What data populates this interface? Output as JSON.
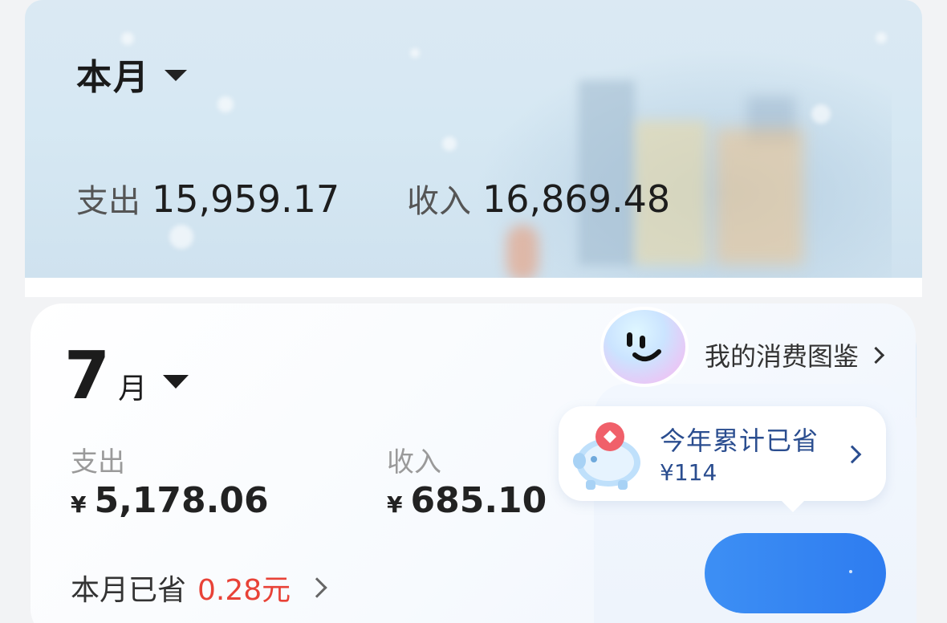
{
  "banner": {
    "period_label": "本月",
    "expense_label": "支出",
    "expense_value": "15,959.17",
    "income_label": "收入",
    "income_value": "16,869.48"
  },
  "month_card": {
    "month_number": "7",
    "month_unit": "月",
    "expense_label": "支出",
    "expense_currency": "¥",
    "expense_value": "5,178.06",
    "income_label": "收入",
    "income_currency": "¥",
    "income_value": "685.10",
    "saved_label": "本月已省",
    "saved_amount": "0.28元"
  },
  "catalog": {
    "link_text": "我的消费图鉴",
    "avatar_icon": "smiley-mascot-icon"
  },
  "savings_tip": {
    "title": "今年累计已省",
    "amount": "¥114",
    "icon": "piggy-bank-icon"
  },
  "colors": {
    "accent_blue": "#2e7cf0",
    "saved_red": "#e84237",
    "tip_text": "#2a4d8f"
  }
}
